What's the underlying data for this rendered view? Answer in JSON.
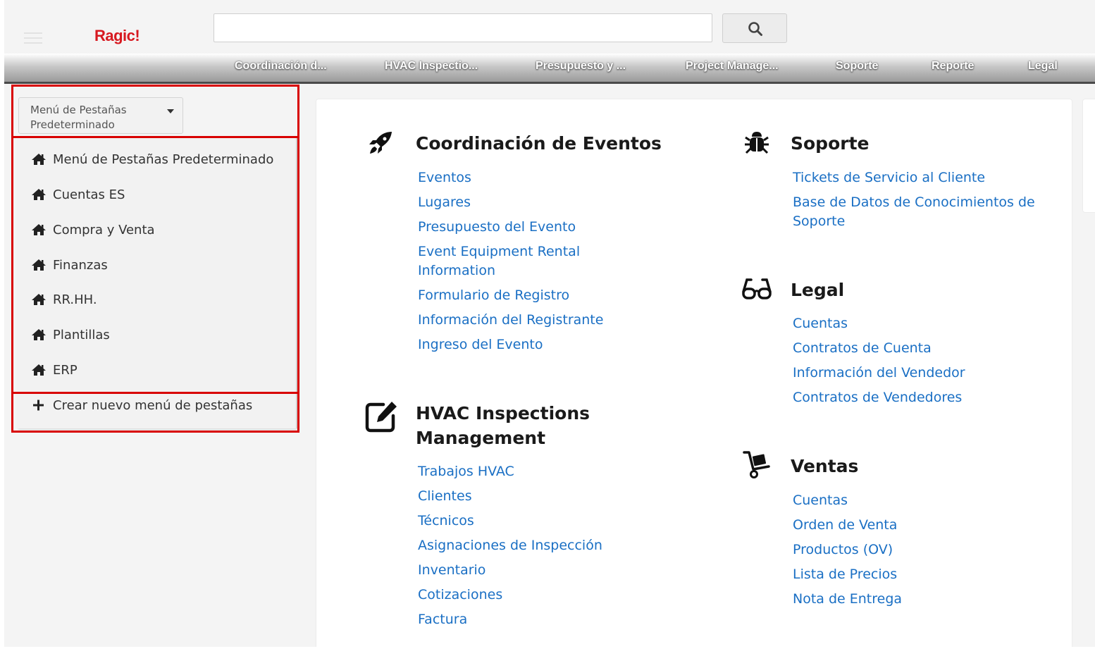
{
  "header": {
    "logo": "Ragic!",
    "search": {
      "placeholder": "",
      "value": ""
    },
    "icons": {
      "menu": "hamburger-icon",
      "search": "search-icon"
    }
  },
  "tabs": [
    {
      "label": "Coordinación d..."
    },
    {
      "label": "HVAC Inspectio..."
    },
    {
      "label": "Presupuesto y ..."
    },
    {
      "label": "Project Manage..."
    },
    {
      "label": "Soporte"
    },
    {
      "label": "Reporte"
    },
    {
      "label": "Legal"
    }
  ],
  "tab_menu": {
    "selected": "Menú de Pestañas Predeterminado",
    "items": [
      {
        "label": "Menú de Pestañas Predeterminado",
        "icon": "home-icon"
      },
      {
        "label": "Cuentas ES",
        "icon": "home-icon"
      },
      {
        "label": "Compra y Venta",
        "icon": "home-icon"
      },
      {
        "label": "Finanzas",
        "icon": "home-icon"
      },
      {
        "label": "RR.HH.",
        "icon": "home-icon"
      },
      {
        "label": "Plantillas",
        "icon": "home-icon"
      },
      {
        "label": "ERP",
        "icon": "home-icon"
      }
    ],
    "create": {
      "label": "Crear nuevo menú de pestañas",
      "icon": "plus-icon"
    }
  },
  "sections": {
    "eventos": {
      "title": "Coordinación de Eventos",
      "icon": "rocket-icon",
      "links": [
        "Eventos",
        "Lugares",
        "Presupuesto del Evento",
        "Event Equipment Rental Information",
        "Formulario de Registro",
        "Información del Registrante",
        "Ingreso del Evento"
      ]
    },
    "hvac": {
      "title": "HVAC Inspections Management",
      "icon": "edit-icon",
      "links": [
        "Trabajos HVAC",
        "Clientes",
        "Técnicos",
        "Asignaciones de Inspección",
        "Inventario",
        "Cotizaciones",
        "Factura"
      ]
    },
    "soporte": {
      "title": "Soporte",
      "icon": "bug-icon",
      "links": [
        "Tickets de Servicio al Cliente",
        "Base de Datos de Conocimientos de Soporte"
      ]
    },
    "legal": {
      "title": "Legal",
      "icon": "glasses-icon",
      "links": [
        "Cuentas",
        "Contratos de Cuenta",
        "Información del Vendedor",
        "Contratos de Vendedores"
      ]
    },
    "ventas": {
      "title": "Ventas",
      "icon": "hand-truck-icon",
      "links": [
        "Cuentas",
        "Orden de Venta",
        "Productos (OV)",
        "Lista de Precios",
        "Nota de Entrega"
      ]
    }
  },
  "colors": {
    "link": "#1a6fc4",
    "logo": "#d71920",
    "highlight": "#d80000"
  }
}
